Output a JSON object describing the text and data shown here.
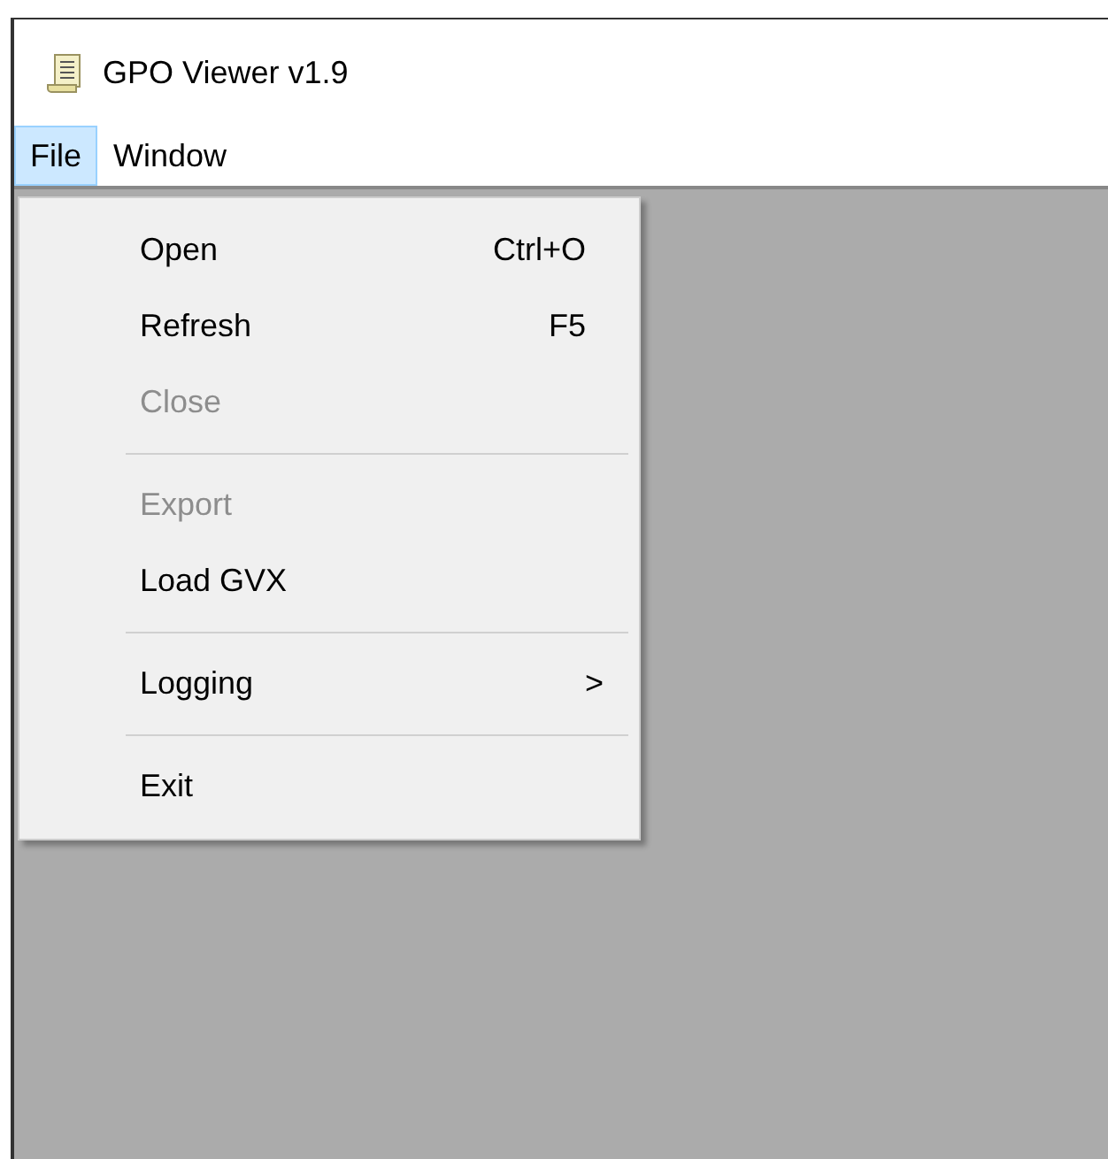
{
  "window": {
    "title": "GPO Viewer v1.9"
  },
  "menu_bar": [
    {
      "label": "File",
      "selected": true
    },
    {
      "label": "Window",
      "selected": false
    }
  ],
  "file_menu": [
    {
      "kind": "item",
      "label": "Open",
      "shortcut": "Ctrl+O",
      "disabled": false
    },
    {
      "kind": "item",
      "label": "Refresh",
      "shortcut": "F5",
      "disabled": false
    },
    {
      "kind": "item",
      "label": "Close",
      "disabled": true
    },
    {
      "kind": "separator"
    },
    {
      "kind": "item",
      "label": "Export",
      "disabled": true
    },
    {
      "kind": "item",
      "label": "Load GVX",
      "disabled": false
    },
    {
      "kind": "separator"
    },
    {
      "kind": "submenu",
      "label": "Logging",
      "arrow": ">",
      "disabled": false
    },
    {
      "kind": "separator"
    },
    {
      "kind": "item",
      "label": "Exit",
      "disabled": false
    }
  ]
}
